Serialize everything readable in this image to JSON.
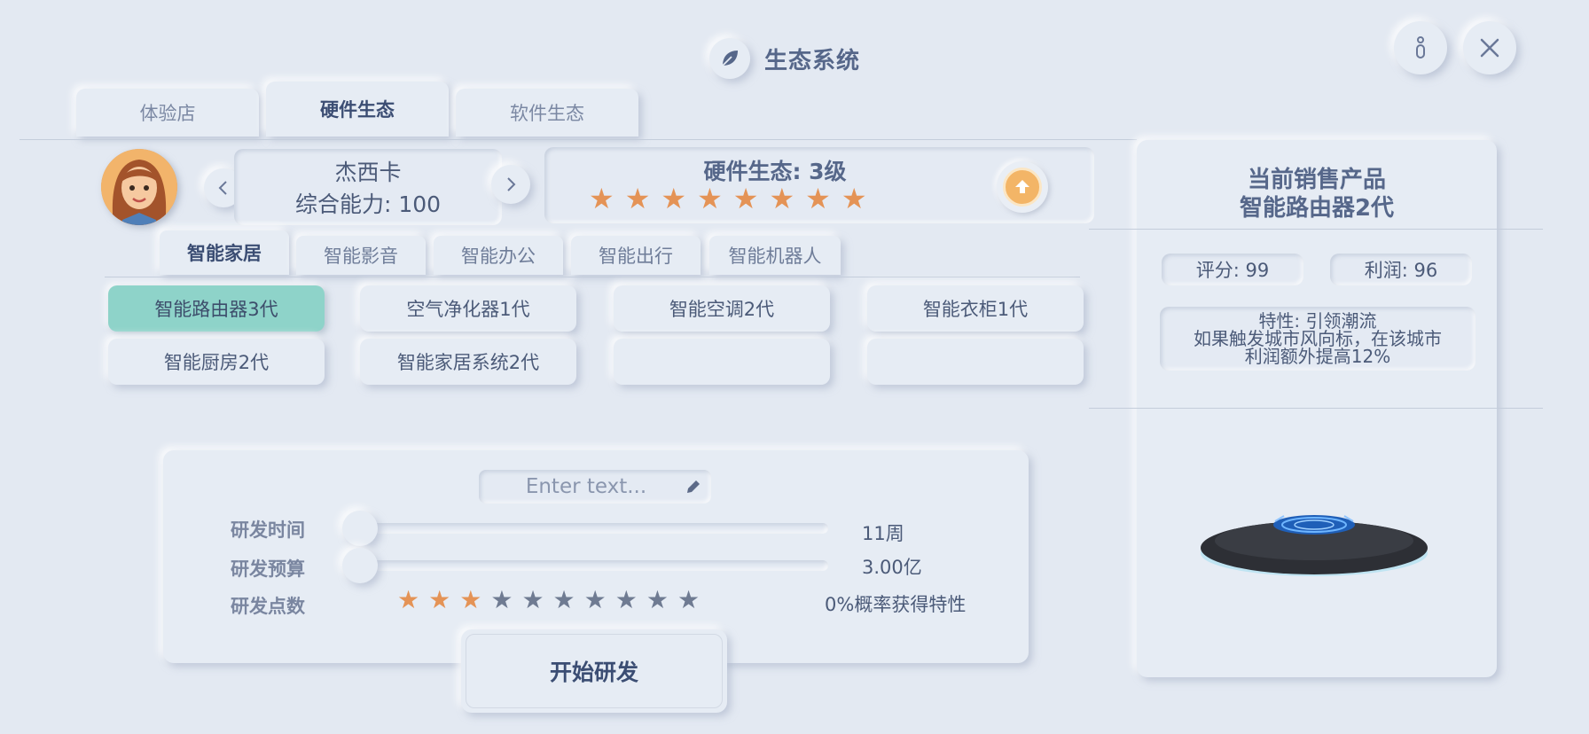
{
  "header": {
    "title": "生态系统",
    "leaf_icon": "leaf-icon",
    "info_icon": "info-icon",
    "close_icon": "close-icon"
  },
  "tabs": [
    {
      "label": "体验店",
      "active": false
    },
    {
      "label": "硬件生态",
      "active": true
    },
    {
      "label": "软件生态",
      "active": false
    }
  ],
  "character": {
    "name": "杰西卡",
    "ability": "综合能力: 100",
    "prev_icon": "chevron-left-icon",
    "next_icon": "chevron-right-icon"
  },
  "level_panel": {
    "title": "硬件生态: 3级",
    "stars_filled": 8,
    "stars_total": 8,
    "upgrade_icon": "upgrade-arrow-icon"
  },
  "sub_tabs": [
    {
      "label": "智能家居",
      "active": true
    },
    {
      "label": "智能影音",
      "active": false
    },
    {
      "label": "智能办公",
      "active": false
    },
    {
      "label": "智能出行",
      "active": false
    },
    {
      "label": "智能机器人",
      "active": false
    }
  ],
  "products": [
    "智能路由器3代",
    "空气净化器1代",
    "智能空调2代",
    "智能衣柜1代",
    "智能厨房2代",
    "智能家居系统2代",
    "",
    ""
  ],
  "research": {
    "name_placeholder": "Enter text...",
    "edit_icon": "pencil-icon",
    "time_label": "研发时间",
    "time_value": "11周",
    "time_slider": 0.0,
    "budget_label": "研发预算",
    "budget_value": "3.00亿",
    "budget_slider": 0.0,
    "points_label": "研发点数",
    "points_filled": 3,
    "points_total": 10,
    "trait_chance": "0%概率获得特性",
    "start_button": "开始研发"
  },
  "right_panel": {
    "heading_line1": "当前销售产品",
    "heading_line2": "智能路由器2代",
    "score": "评分: 99",
    "profit": "利润: 96",
    "trait_line1": "特性: 引领潮流",
    "trait_line2": "如果触发城市风向标，在该城市",
    "trait_line3": "利润额外提高12%"
  },
  "colors": {
    "accent_green": "#8ed3c9",
    "star_on": "#e49356",
    "star_off": "#6f7b92",
    "background": "#e3e9f2"
  }
}
